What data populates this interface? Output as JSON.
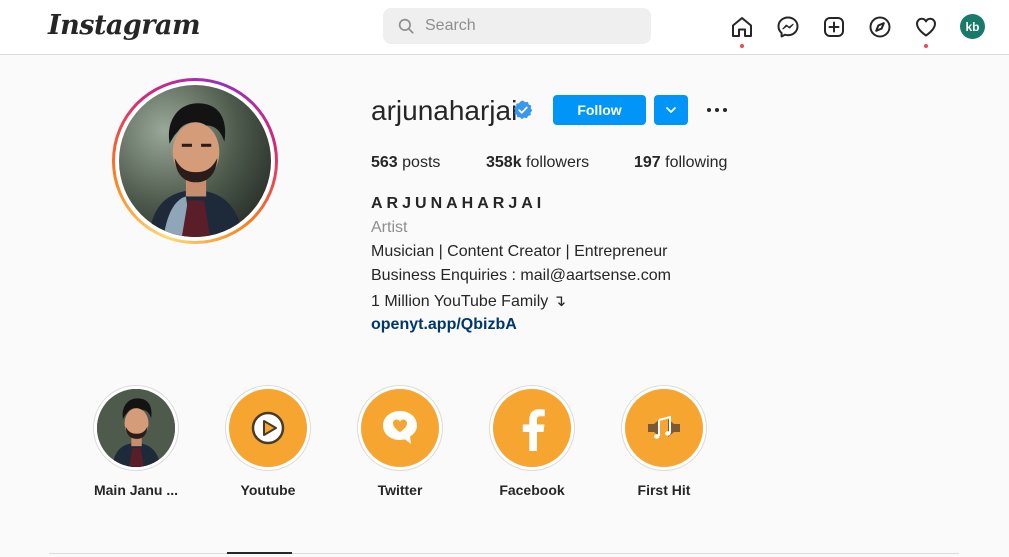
{
  "app": {
    "logo": "Instagram"
  },
  "search": {
    "placeholder": "Search"
  },
  "nav": {
    "items": [
      {
        "name": "home",
        "icon": "home-icon"
      },
      {
        "name": "messenger",
        "icon": "messenger-icon"
      },
      {
        "name": "new-post",
        "icon": "plus-square-icon"
      },
      {
        "name": "explore",
        "icon": "compass-icon"
      },
      {
        "name": "activity",
        "icon": "heart-icon"
      }
    ],
    "avatar_initials": "kb"
  },
  "profile": {
    "username": "arjunaharjai",
    "verified": true,
    "follow_label": "Follow",
    "stats": {
      "posts_count": "563",
      "posts_label": "posts",
      "followers_count": "358k",
      "followers_label": "followers",
      "following_count": "197",
      "following_label": "following"
    },
    "full_name": "ARJUNAHARJAI",
    "category": "Artist",
    "bio_lines": [
      "Musician | Content Creator | Entrepreneur",
      "Business Enquiries : mail@aartsense.com",
      "1 Million YouTube Family ↴"
    ],
    "link": "openyt.app/QbizbA"
  },
  "highlights": [
    {
      "label": "Main Janu ...",
      "icon": "profile-photo"
    },
    {
      "label": "Youtube",
      "icon": "play-icon"
    },
    {
      "label": "Twitter",
      "icon": "heart-bubble-icon"
    },
    {
      "label": "Facebook",
      "icon": "facebook-icon"
    },
    {
      "label": "First Hit",
      "icon": "music-notes-icon"
    }
  ],
  "colors": {
    "accent": "#0095f6",
    "highlight_bg": "#f7a531",
    "link": "#00376b",
    "notification_dot": "#ed4956",
    "avatar_bg": "#1a7a6a"
  }
}
